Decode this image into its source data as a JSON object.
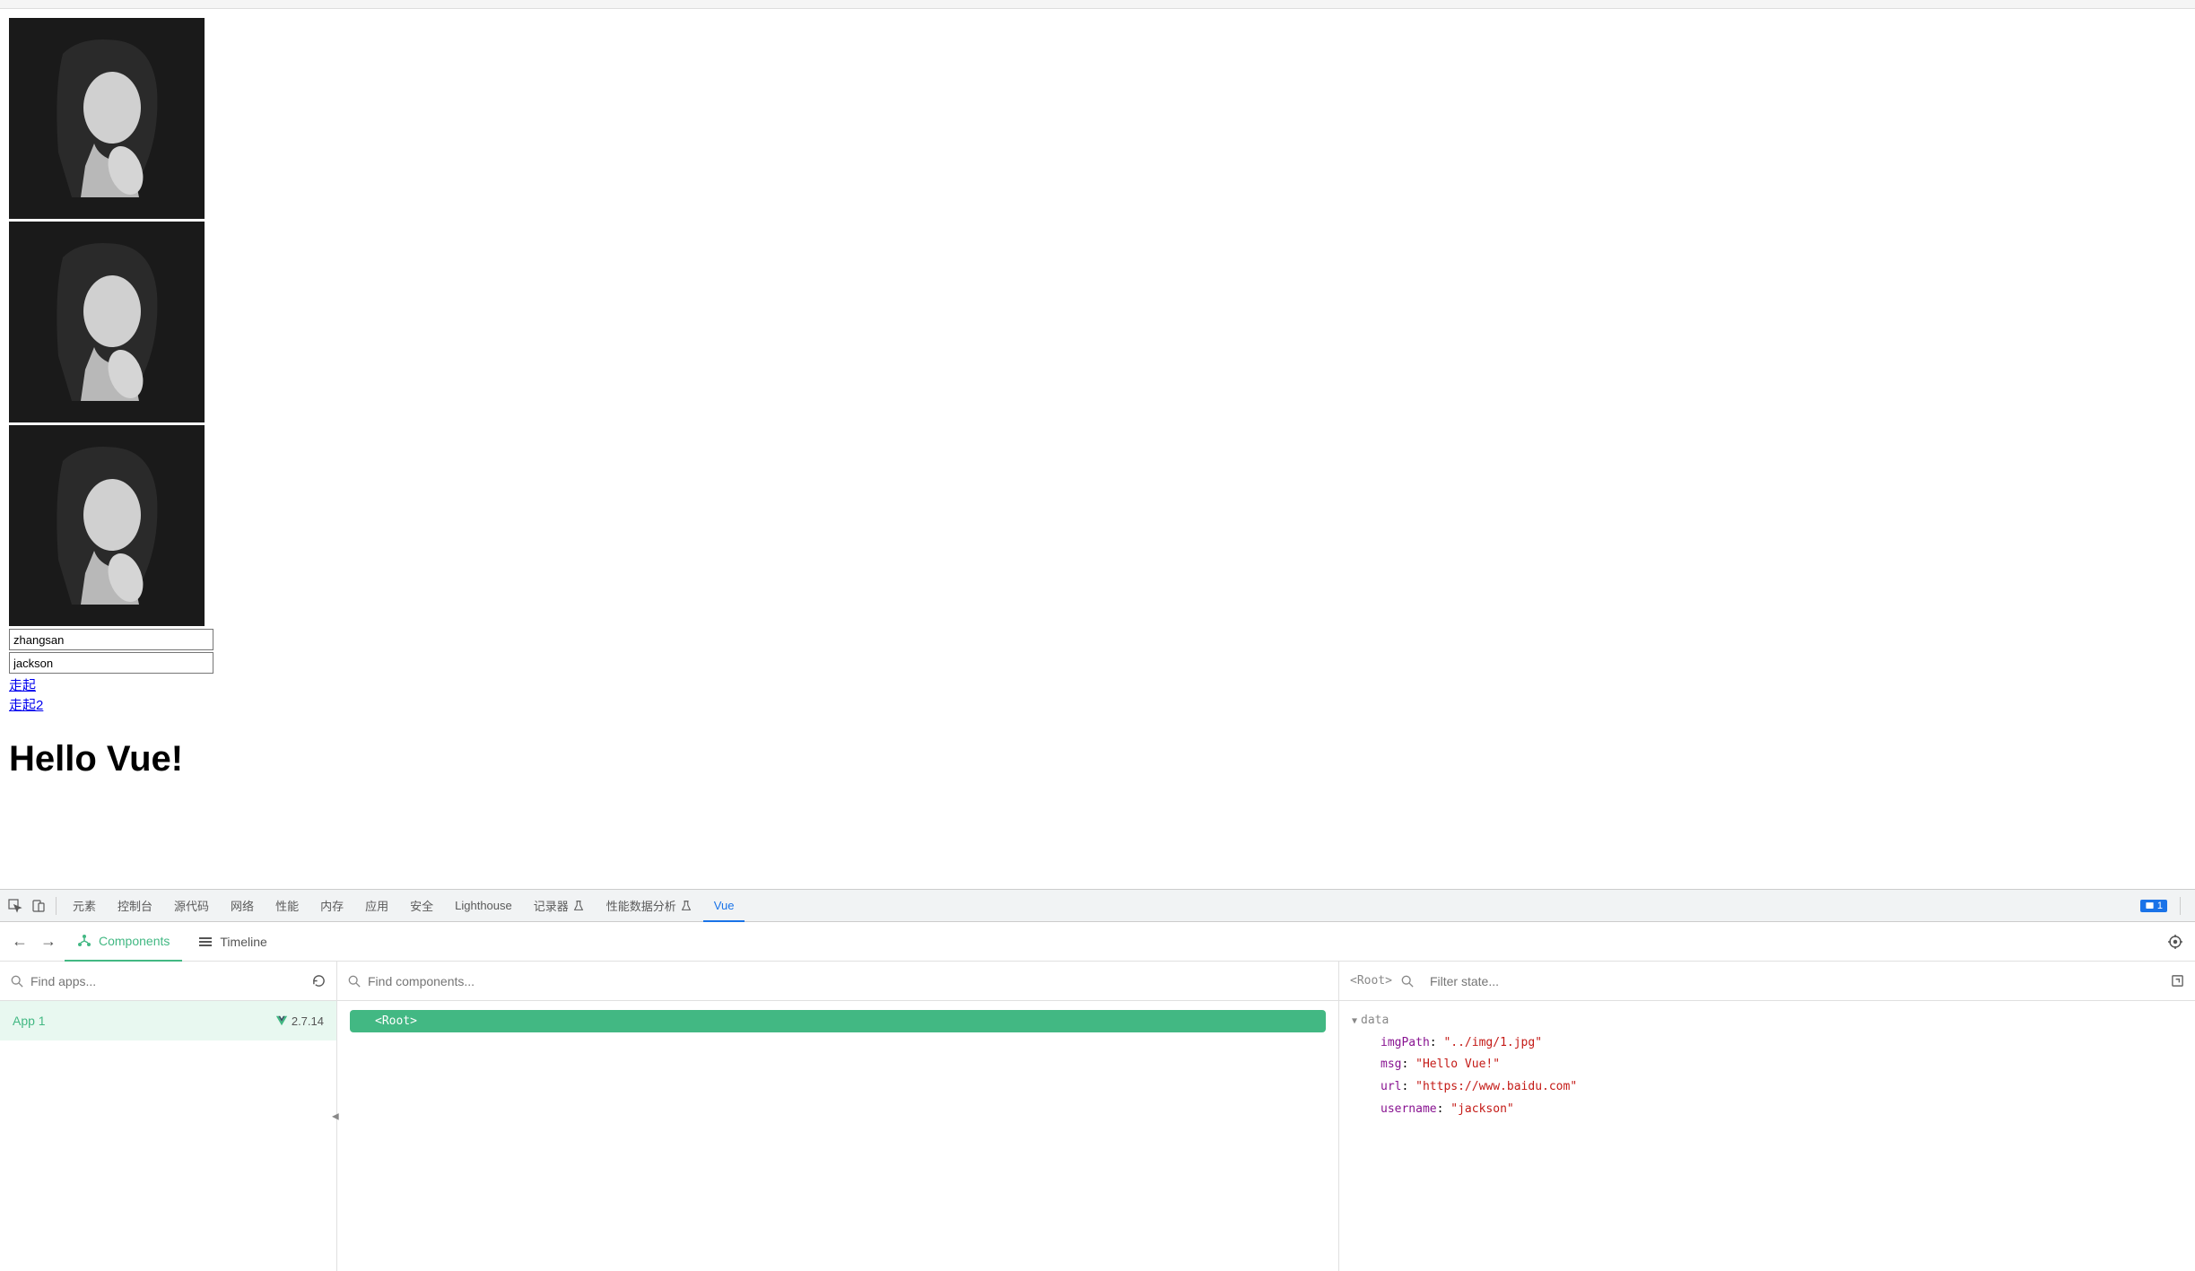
{
  "page": {
    "input1_value": "zhangsan",
    "input2_value": "jackson",
    "link1_text": "走起",
    "link2_text": "走起2",
    "heading_text": "Hello Vue!"
  },
  "devtools": {
    "tabs": [
      "元素",
      "控制台",
      "源代码",
      "网络",
      "性能",
      "内存",
      "应用",
      "安全",
      "Lighthouse",
      "记录器",
      "性能数据分析",
      "Vue"
    ],
    "active_tab": "Vue",
    "badge_count": "1"
  },
  "vue_devtools": {
    "subtabs": {
      "components": "Components",
      "timeline": "Timeline"
    },
    "apps_search_placeholder": "Find apps...",
    "components_search_placeholder": "Find components...",
    "state_search_placeholder": "Filter state...",
    "app_name": "App 1",
    "vue_version": "2.7.14",
    "root_node": "<Root>",
    "state_root_label": "<Root>",
    "data_section": "data",
    "state": {
      "imgPath_key": "imgPath",
      "imgPath_val": "\"../img/1.jpg\"",
      "msg_key": "msg",
      "msg_val": "\"Hello Vue!\"",
      "url_key": "url",
      "url_val": "\"https://www.baidu.com\"",
      "username_key": "username",
      "username_val": "\"jackson\""
    }
  }
}
